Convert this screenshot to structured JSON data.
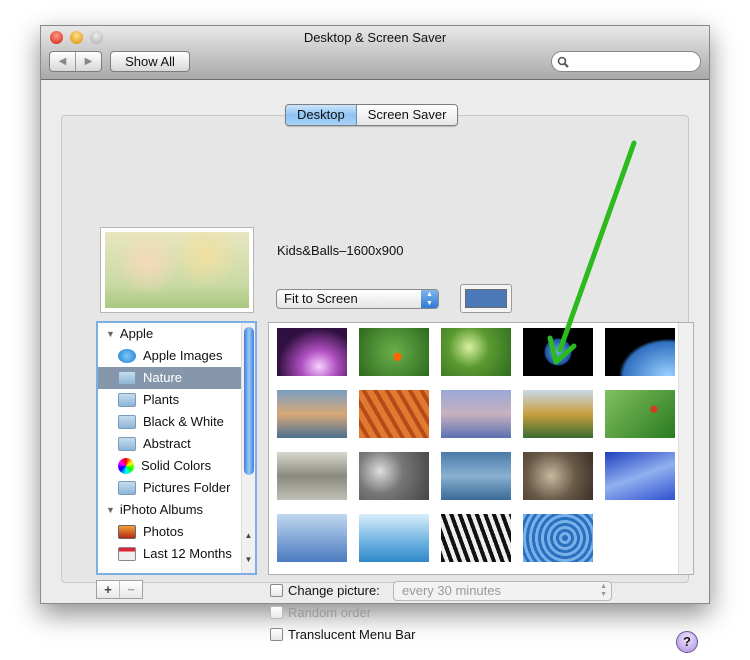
{
  "window": {
    "title": "Desktop & Screen Saver"
  },
  "toolbar": {
    "back": "◀",
    "forward": "▶",
    "show_all": "Show All",
    "search_placeholder": ""
  },
  "tabs": [
    {
      "label": "Desktop",
      "selected": true
    },
    {
      "label": "Screen Saver",
      "selected": false
    }
  ],
  "desktop": {
    "image_name": "Kids&Balls–1600x900",
    "fit_option": "Fit to Screen",
    "color_swatch": "#4a78b8"
  },
  "sources": {
    "groups": [
      {
        "label": "Apple",
        "items": [
          {
            "label": "Apple Images",
            "icon": "apple-icon"
          },
          {
            "label": "Nature",
            "icon": "folder-icon",
            "selected": true
          },
          {
            "label": "Plants",
            "icon": "folder-icon"
          },
          {
            "label": "Black & White",
            "icon": "folder-icon"
          },
          {
            "label": "Abstract",
            "icon": "folder-icon"
          },
          {
            "label": "Solid Colors",
            "icon": "color-wheel-icon"
          },
          {
            "label": "Pictures Folder",
            "icon": "pictures-folder-icon"
          }
        ]
      },
      {
        "label": "iPhoto Albums",
        "items": [
          {
            "label": "Photos",
            "icon": "photos-icon"
          },
          {
            "label": "Last 12 Months",
            "icon": "calendar-icon"
          }
        ]
      }
    ],
    "add": "+",
    "remove": "−"
  },
  "options": {
    "change_picture": "Change picture:",
    "interval": "every 30 minutes",
    "random_order": "Random order",
    "translucent_menu_bar": "Translucent Menu Bar",
    "help": "?"
  },
  "annotation": {
    "arrow_color": "#2bbb1f"
  }
}
